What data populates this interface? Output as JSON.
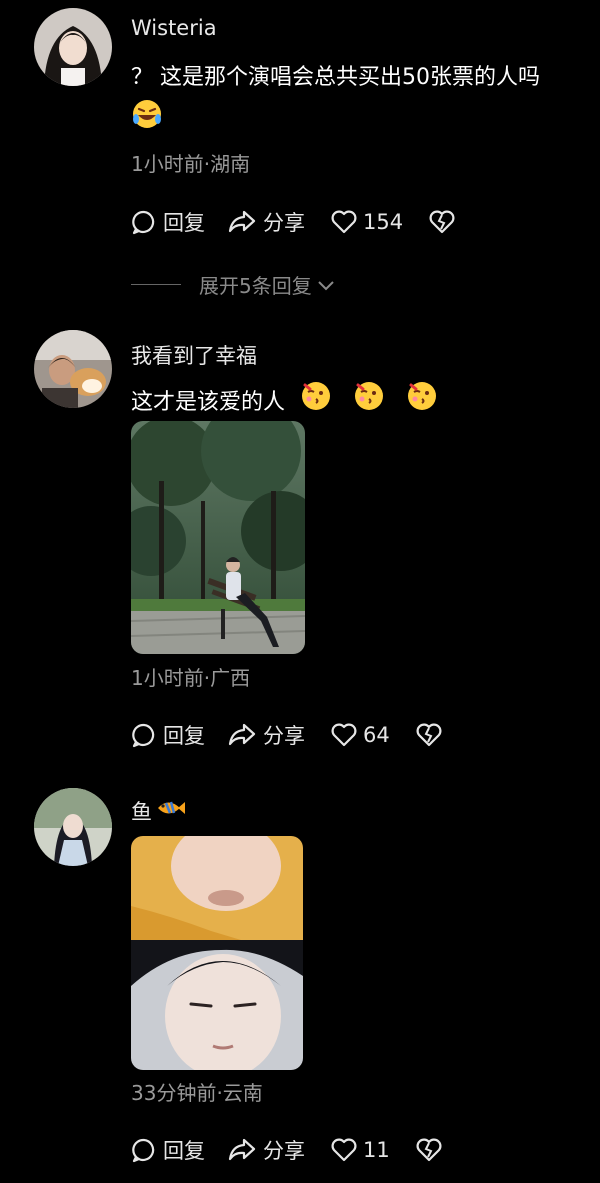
{
  "comments": [
    {
      "username": "Wisteria",
      "text": "？ 这是那个演唱会总共买出50张票的人吗",
      "time_location": "1小时前·湖南",
      "reply": "回复",
      "share": "分享",
      "likes": "154",
      "expand_text": "展开5条回复",
      "avatar_icon": "avatar-girl-portrait",
      "emoji": "rolling-laughing-emoji"
    },
    {
      "username": "我看到了幸福",
      "text": "这才是该爱的人",
      "time_location": "1小时前·广西",
      "reply": "回复",
      "share": "分享",
      "likes": "64",
      "avatar_icon": "avatar-person-with-dog",
      "emoji": "kiss-face-emoji",
      "photo": "man-sitting-on-park-bench"
    },
    {
      "username": "鱼",
      "time_location": "33分钟前·云南",
      "reply": "回复",
      "share": "分享",
      "likes": "11",
      "avatar_icon": "avatar-costume-portrait",
      "emoji": "fish-emoji",
      "photo": "two-face-closeups"
    }
  ],
  "colors": {
    "background": "#000000",
    "meta_text": "#9a9a9a",
    "action_text": "#e6e6e6"
  }
}
